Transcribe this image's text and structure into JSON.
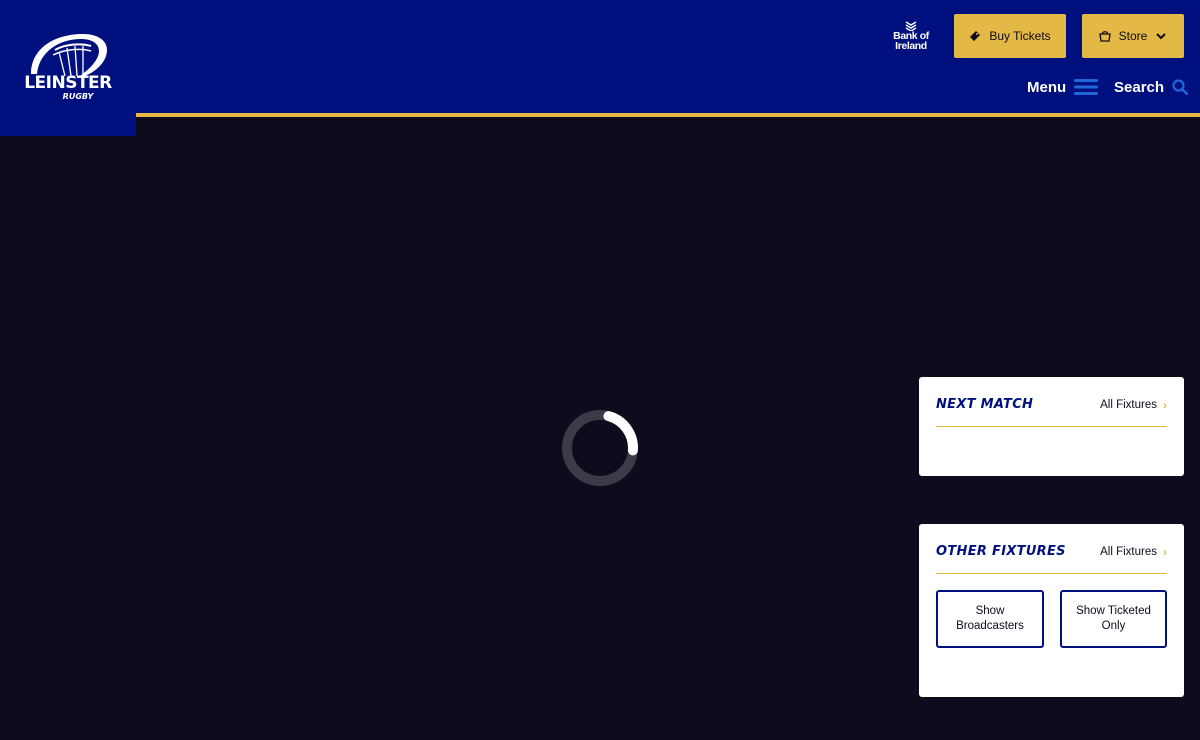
{
  "brand": {
    "name": "LEINSTER",
    "sub": "RUGBY"
  },
  "sponsor": {
    "line1": "Bank of",
    "line2": "Ireland"
  },
  "header": {
    "buy_tickets": "Buy Tickets",
    "store": "Store",
    "menu": "Menu",
    "search": "Search"
  },
  "next_match": {
    "title": "NEXT MATCH",
    "link": "All Fixtures"
  },
  "other_fixtures": {
    "title": "OTHER FIXTURES",
    "link": "All Fixtures",
    "filter_broadcasters": "Show Broadcasters",
    "filter_ticketed": "Show Ticketed Only"
  },
  "colors": {
    "navy": "#00117f",
    "gold": "#e4b844",
    "bg": "#0d0b1c",
    "accent_blue": "#1f66d9"
  },
  "icons": [
    "leinster-logo",
    "bank-of-ireland-logo",
    "ticket-icon",
    "basket-icon",
    "chevron-down-icon",
    "hamburger-icon",
    "search-icon",
    "loading-spinner",
    "chevron-right-icon"
  ]
}
